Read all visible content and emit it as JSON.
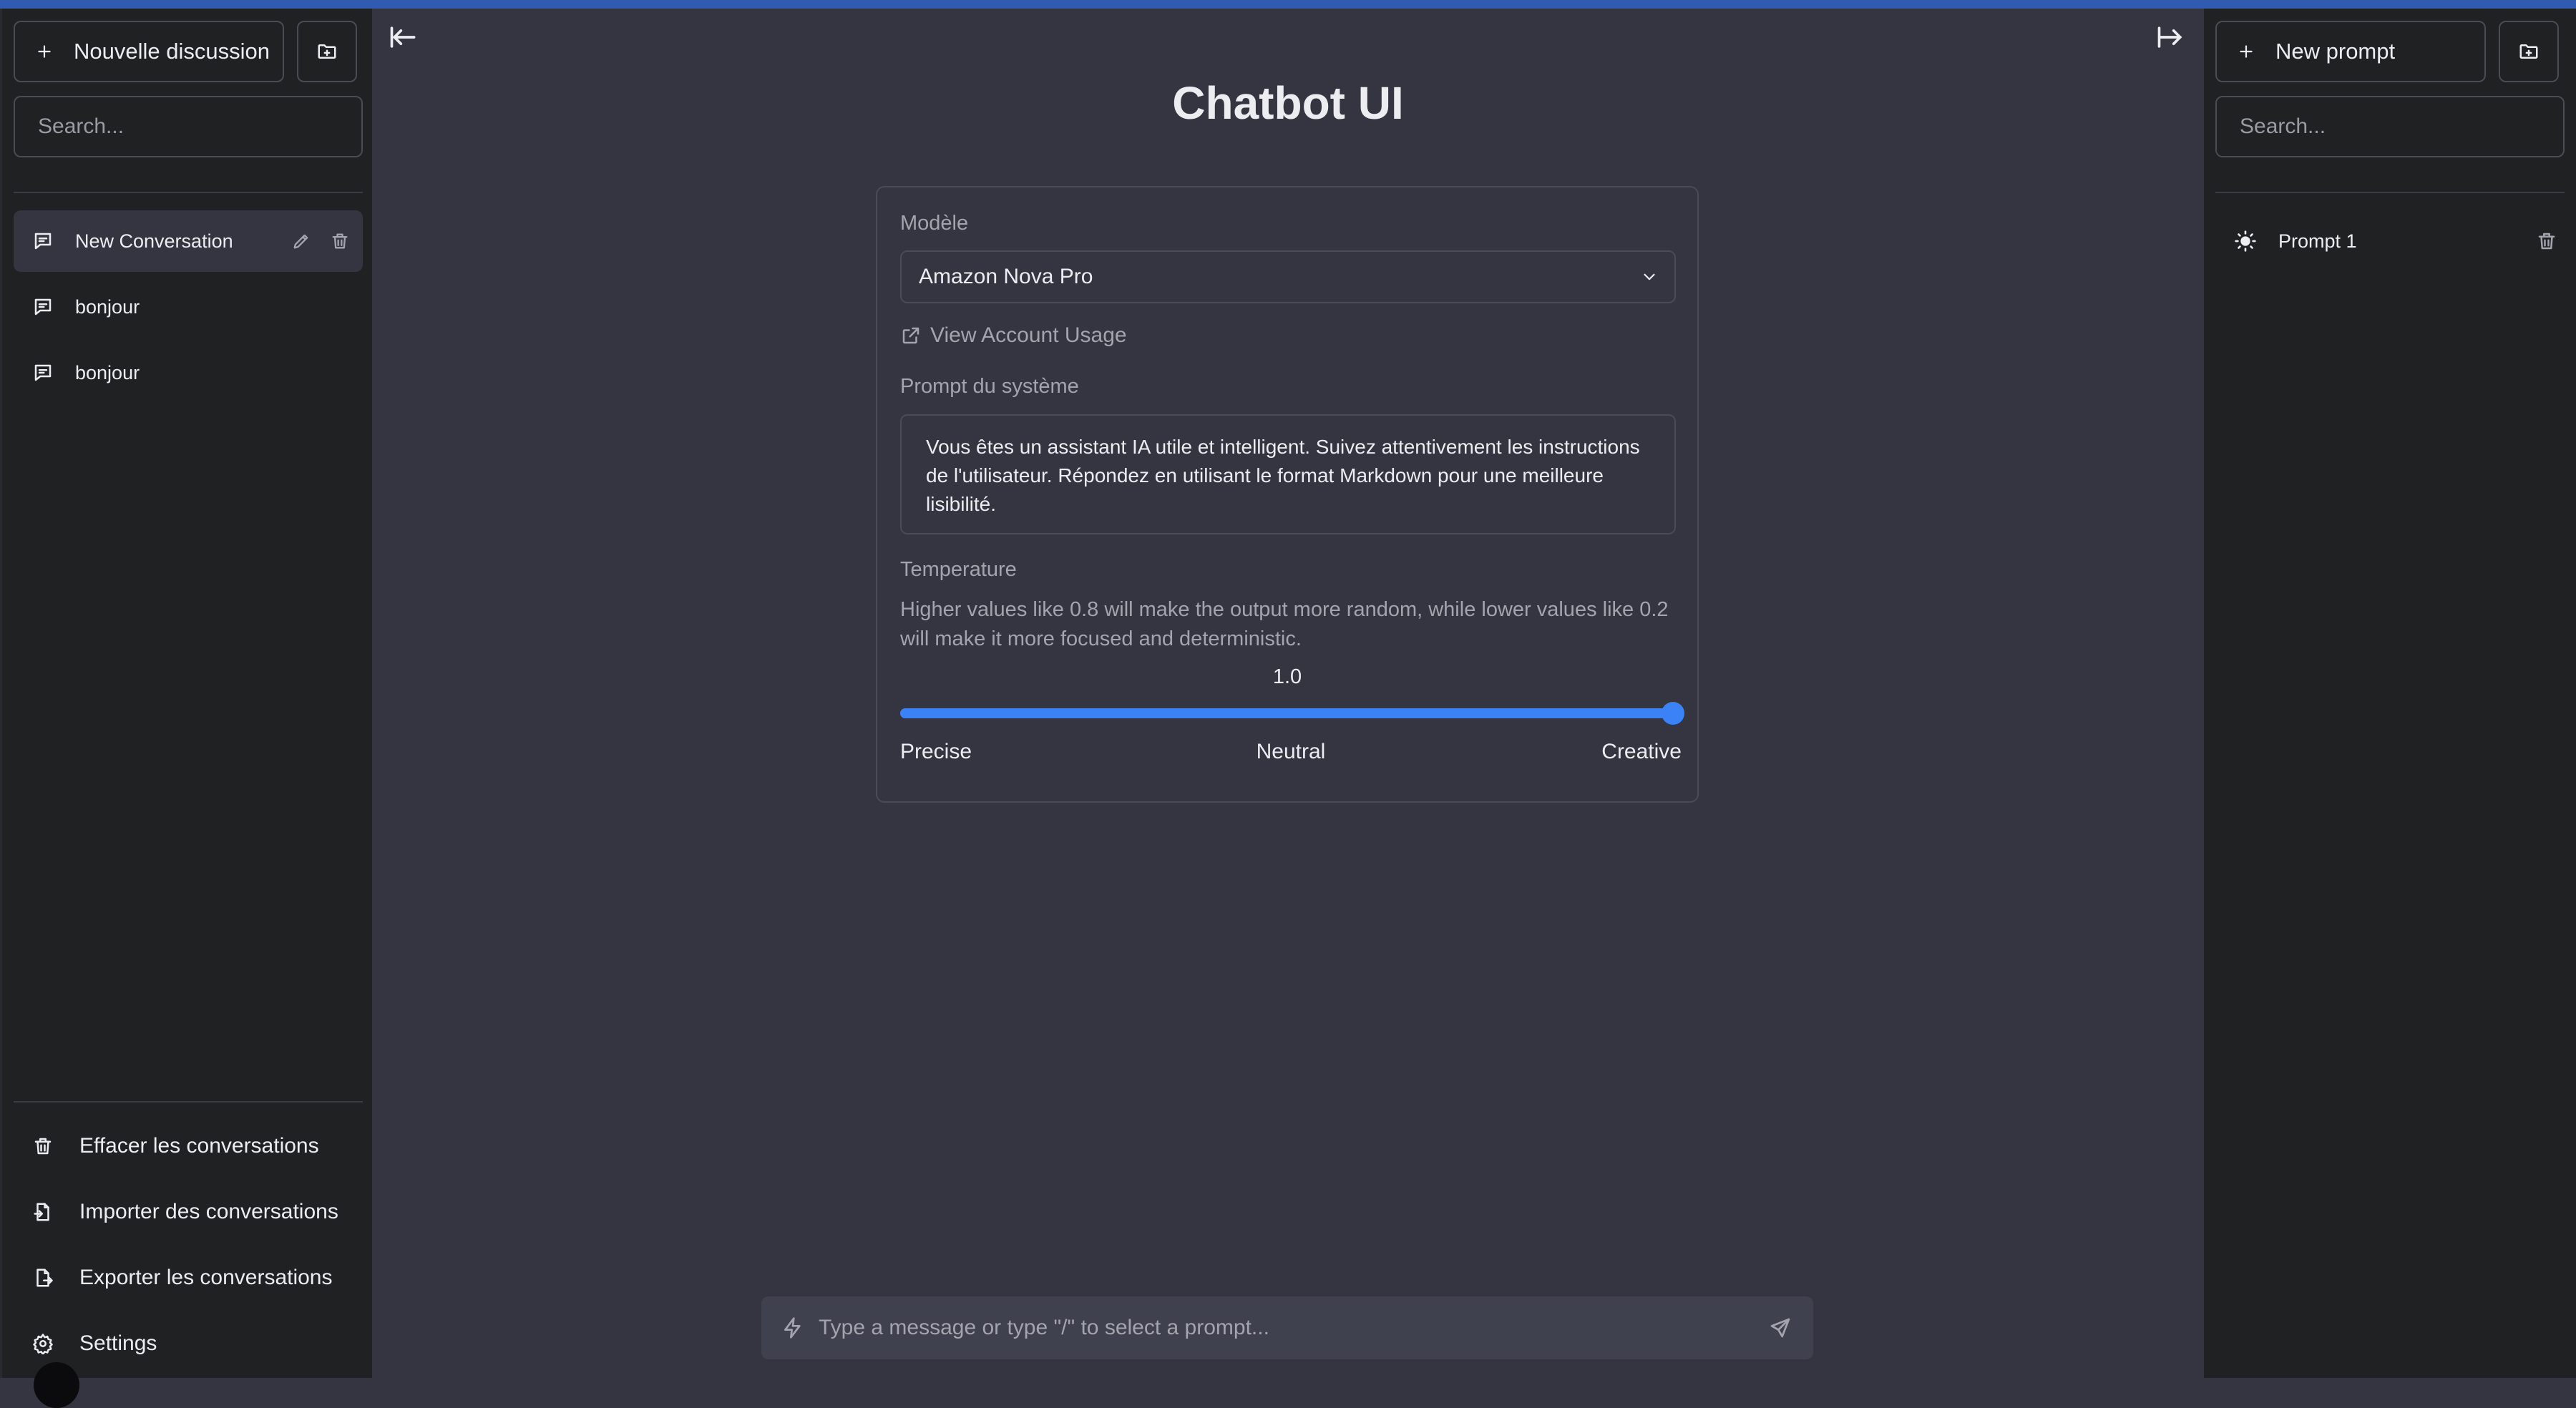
{
  "left_sidebar": {
    "new_chat_label": "Nouvelle discussion",
    "search_placeholder": "Search...",
    "conversations": [
      {
        "label": "New Conversation"
      },
      {
        "label": "bonjour"
      },
      {
        "label": "bonjour"
      }
    ],
    "bottom_actions": [
      {
        "label": "Effacer les conversations"
      },
      {
        "label": "Importer des conversations"
      },
      {
        "label": "Exporter les conversations"
      },
      {
        "label": "Settings"
      }
    ]
  },
  "main": {
    "title": "Chatbot UI",
    "model_label": "Modèle",
    "model_selected": "Amazon Nova Pro",
    "usage_link": "View Account Usage",
    "system_prompt_label": "Prompt du système",
    "system_prompt_value": "Vous êtes un assistant IA utile et intelligent. Suivez attentivement les instructions de l'utilisateur. Répondez en utilisant le format Markdown pour une meilleure lisibilité.",
    "temperature_label": "Temperature",
    "temperature_description": "Higher values like 0.8 will make the output more random, while lower values like 0.2 will make it more focused and deterministic.",
    "temperature_value": "1.0",
    "temperature_level": 1.0,
    "slider_labels": {
      "left": "Precise",
      "middle": "Neutral",
      "right": "Creative"
    },
    "chat_placeholder": "Type a message or type \"/\" to select a prompt..."
  },
  "right_sidebar": {
    "new_prompt_label": "New prompt",
    "search_placeholder": "Search...",
    "prompts": [
      {
        "label": "Prompt 1"
      }
    ]
  },
  "colors": {
    "accent": "#3b82f6",
    "sidebar_bg": "#202123",
    "main_bg": "#343541",
    "top_bar": "#2f5bb0"
  }
}
